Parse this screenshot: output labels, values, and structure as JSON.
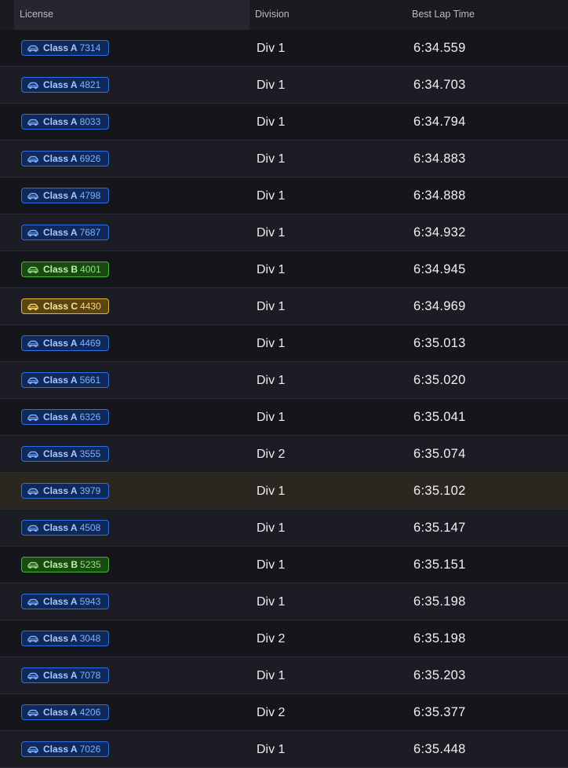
{
  "table": {
    "headers": {
      "license": "License",
      "division": "Division",
      "best_lap": "Best Lap Time"
    },
    "colors": {
      "class_a": "#2f6fe0",
      "class_b": "#45b82e",
      "class_c": "#e0b53a",
      "highlight_row": "#2a2720"
    },
    "rows": [
      {
        "license_class": "Class A",
        "license_number": "7314",
        "division": "Div 1",
        "best_lap": "6:34.559",
        "icon": "car-icon"
      },
      {
        "license_class": "Class A",
        "license_number": "4821",
        "division": "Div 1",
        "best_lap": "6:34.703",
        "icon": "car-icon"
      },
      {
        "license_class": "Class A",
        "license_number": "8033",
        "division": "Div 1",
        "best_lap": "6:34.794",
        "icon": "car-icon"
      },
      {
        "license_class": "Class A",
        "license_number": "6926",
        "division": "Div 1",
        "best_lap": "6:34.883",
        "icon": "car-icon"
      },
      {
        "license_class": "Class A",
        "license_number": "4798",
        "division": "Div 1",
        "best_lap": "6:34.888",
        "icon": "car-icon"
      },
      {
        "license_class": "Class A",
        "license_number": "7687",
        "division": "Div 1",
        "best_lap": "6:34.932",
        "icon": "car-icon"
      },
      {
        "license_class": "Class B",
        "license_number": "4001",
        "division": "Div 1",
        "best_lap": "6:34.945",
        "icon": "car-icon"
      },
      {
        "license_class": "Class C",
        "license_number": "4430",
        "division": "Div 1",
        "best_lap": "6:34.969",
        "icon": "car-icon"
      },
      {
        "license_class": "Class A",
        "license_number": "4469",
        "division": "Div 1",
        "best_lap": "6:35.013",
        "icon": "car-icon"
      },
      {
        "license_class": "Class A",
        "license_number": "5661",
        "division": "Div 1",
        "best_lap": "6:35.020",
        "icon": "car-icon"
      },
      {
        "license_class": "Class A",
        "license_number": "6326",
        "division": "Div 1",
        "best_lap": "6:35.041",
        "icon": "car-icon"
      },
      {
        "license_class": "Class A",
        "license_number": "3555",
        "division": "Div 2",
        "best_lap": "6:35.074",
        "icon": "car-icon"
      },
      {
        "license_class": "Class A",
        "license_number": "3979",
        "division": "Div 1",
        "best_lap": "6:35.102",
        "icon": "car-icon",
        "highlighted": true
      },
      {
        "license_class": "Class A",
        "license_number": "4508",
        "division": "Div 1",
        "best_lap": "6:35.147",
        "icon": "car-icon"
      },
      {
        "license_class": "Class B",
        "license_number": "5235",
        "division": "Div 1",
        "best_lap": "6:35.151",
        "icon": "car-icon"
      },
      {
        "license_class": "Class A",
        "license_number": "5943",
        "division": "Div 1",
        "best_lap": "6:35.198",
        "icon": "car-icon"
      },
      {
        "license_class": "Class A",
        "license_number": "3048",
        "division": "Div 2",
        "best_lap": "6:35.198",
        "icon": "car-icon"
      },
      {
        "license_class": "Class A",
        "license_number": "7078",
        "division": "Div 1",
        "best_lap": "6:35.203",
        "icon": "car-icon"
      },
      {
        "license_class": "Class A",
        "license_number": "4206",
        "division": "Div 2",
        "best_lap": "6:35.377",
        "icon": "car-icon"
      },
      {
        "license_class": "Class A",
        "license_number": "7026",
        "division": "Div 1",
        "best_lap": "6:35.448",
        "icon": "car-icon"
      }
    ]
  }
}
